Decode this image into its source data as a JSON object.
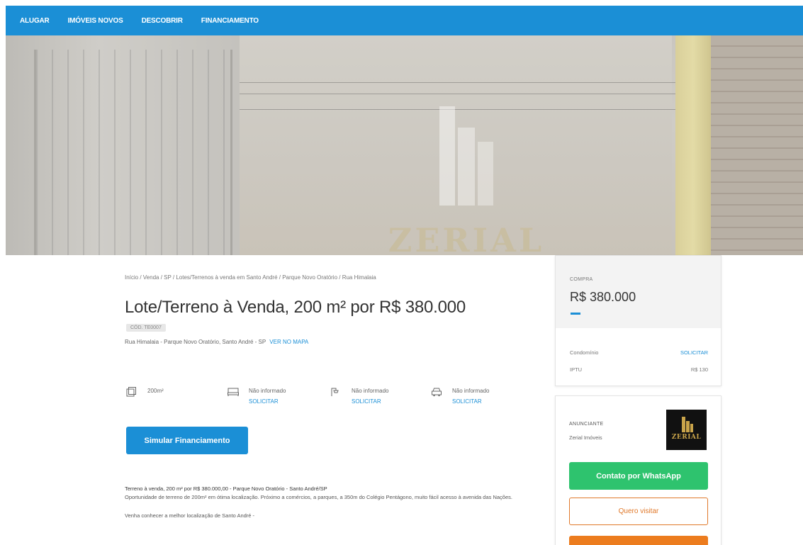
{
  "nav": {
    "items": [
      "ALUGAR",
      "IMÓVEIS NOVOS",
      "DESCOBRIR",
      "FINANCIAMENTO"
    ]
  },
  "hero": {
    "watermark_text": "ZERIAL"
  },
  "listing": {
    "breadcrumb": "Início / Venda / SP / Lotes/Terrenos à venda em Santo André / Parque Novo Oratório / Rua Himalaia",
    "title": "Lote/Terreno à Venda, 200 m² por R$ 380.000",
    "code": "CÓD. TE0007",
    "address": "Rua Himalaia - Parque Novo Oratório, Santo André - SP",
    "map_link": "VER NO MAPA",
    "features": {
      "area": "200m²",
      "bedrooms": "Não informado",
      "bathrooms": "Não informado",
      "parking": "Não informado",
      "solicit": "SOLICITAR"
    },
    "simulate_button": "Simular Financiamento",
    "description": {
      "headline": "Terreno à venda, 200 m² por R$ 380.000,00 - Parque Novo Oratório - Santo André/SP",
      "body": "Oportunidade de terreno de 200m² em ótima localização. Próximo a comércios, a parques, a 350m do Colégio Pentágono, muito fácil acesso à avenida das Nações.",
      "closing": "Venha conhecer a melhor localização de Santo André -"
    }
  },
  "price_card": {
    "label": "COMPRA",
    "price": "R$ 380.000",
    "condominio_label": "Condomínio",
    "condominio_value": "SOLICITAR",
    "iptu_label": "IPTU",
    "iptu_value": "R$ 130"
  },
  "advertiser": {
    "label": "ANUNCIANTE",
    "name": "Zerial Imóveis",
    "logo_text": "ZERIAL",
    "whatsapp_button": "Contato por WhatsApp",
    "visit_button": "Quero visitar"
  },
  "colors": {
    "primary": "#1b8fd6",
    "whatsapp": "#2ec36e",
    "orange": "#ec7c1e"
  }
}
